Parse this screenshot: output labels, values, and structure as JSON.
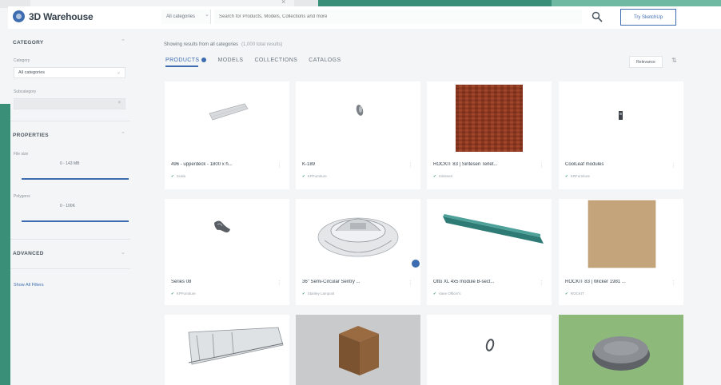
{
  "header": {
    "logo_text": "3D Warehouse",
    "search_category": "All categories",
    "search_placeholder": "Search for Products, Models, Collections and more",
    "try_button": "Try SketchUp"
  },
  "sidebar": {
    "category_title": "CATEGORY",
    "category_label": "Category",
    "category_value": "All categories",
    "subcategory_label": "Subcategory",
    "subcategory_value": "",
    "properties_title": "PROPERTIES",
    "file_size_label": "File size",
    "file_size_value": "0 - 143 MB",
    "polygons_label": "Polygons",
    "polygons_value": "0 - 100K",
    "advanced_title": "ADVANCED",
    "show_all_link": "Show All Filters"
  },
  "main": {
    "results_text": "Showing results from all categories",
    "results_sub": "(1,000 total results)",
    "tabs": [
      {
        "label": "PRODUCTS",
        "active": true
      },
      {
        "label": "MODELS",
        "active": false
      },
      {
        "label": "COLLECTIONS",
        "active": false
      },
      {
        "label": "CATALOGS",
        "active": false
      }
    ],
    "sort_label": "Relevance",
    "sort_dir_icon": "sort-icon"
  },
  "cards": [
    {
      "title": "496 - upperdeck - 1800 x h...",
      "author": "Scala"
    },
    {
      "title": "K-189",
      "author": "KPFurniture"
    },
    {
      "title": "ROCKIT 83 | Sintesen Terlet...",
      "author": "Sintesen"
    },
    {
      "title": "CoolLeaf modules",
      "author": "KRFurniture"
    },
    {
      "title": "Series 08",
      "author": "KPFurniture"
    },
    {
      "title": "36\" Semi-Circular Sentry ...",
      "author": "Stanley Lampost"
    },
    {
      "title": "Otto XL 4x5 module B-sect...",
      "author": "Vane Officer's"
    },
    {
      "title": "ROCKIT 83 | Wicker 1981 ...",
      "author": "ROCKIT"
    },
    {
      "title": "",
      "author": ""
    },
    {
      "title": "",
      "author": ""
    },
    {
      "title": "",
      "author": ""
    },
    {
      "title": "",
      "author": ""
    }
  ],
  "colors": {
    "accent": "#3d6db0",
    "background_green": "#3a8f78"
  }
}
